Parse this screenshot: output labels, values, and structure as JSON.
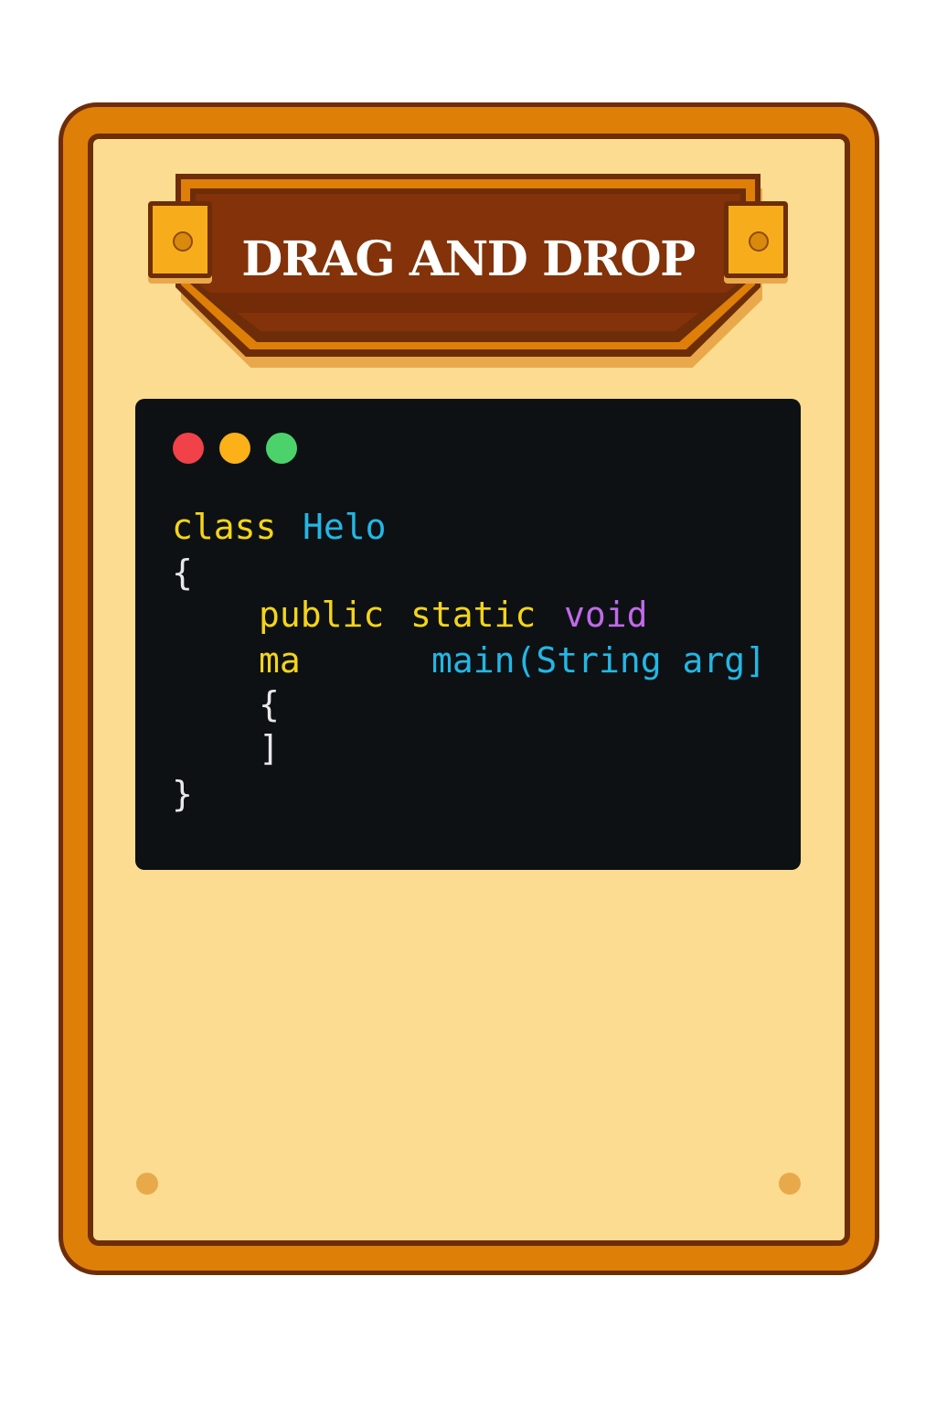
{
  "title": "DRAG AND DROP",
  "colors": {
    "frame_orange": "#de7f08",
    "frame_dark": "#6e2d09",
    "card_bg": "#fbdc90",
    "banner": "#833209",
    "bracket": "#f7ad1b",
    "code_bg": "#0d1114",
    "keyword_yellow": "#f4d41a",
    "keyword_cyan": "#23b7e4",
    "keyword_purple": "#c06ae8",
    "window_red": "#f04248",
    "window_yellow": "#fbb117",
    "window_green": "#4cd26b"
  },
  "code_window": {
    "buttons": [
      "close",
      "minimize",
      "maximize"
    ],
    "lines": {
      "class_kw": "class",
      "class_name": "Helo",
      "open_brace": "{",
      "public_kw": "public",
      "static_kw": "static",
      "void_kw": "void",
      "ma_token": "ma",
      "main_sig": "main(String arg]",
      "inner_open": "{",
      "inner_close": "]",
      "close_brace": "}"
    }
  }
}
